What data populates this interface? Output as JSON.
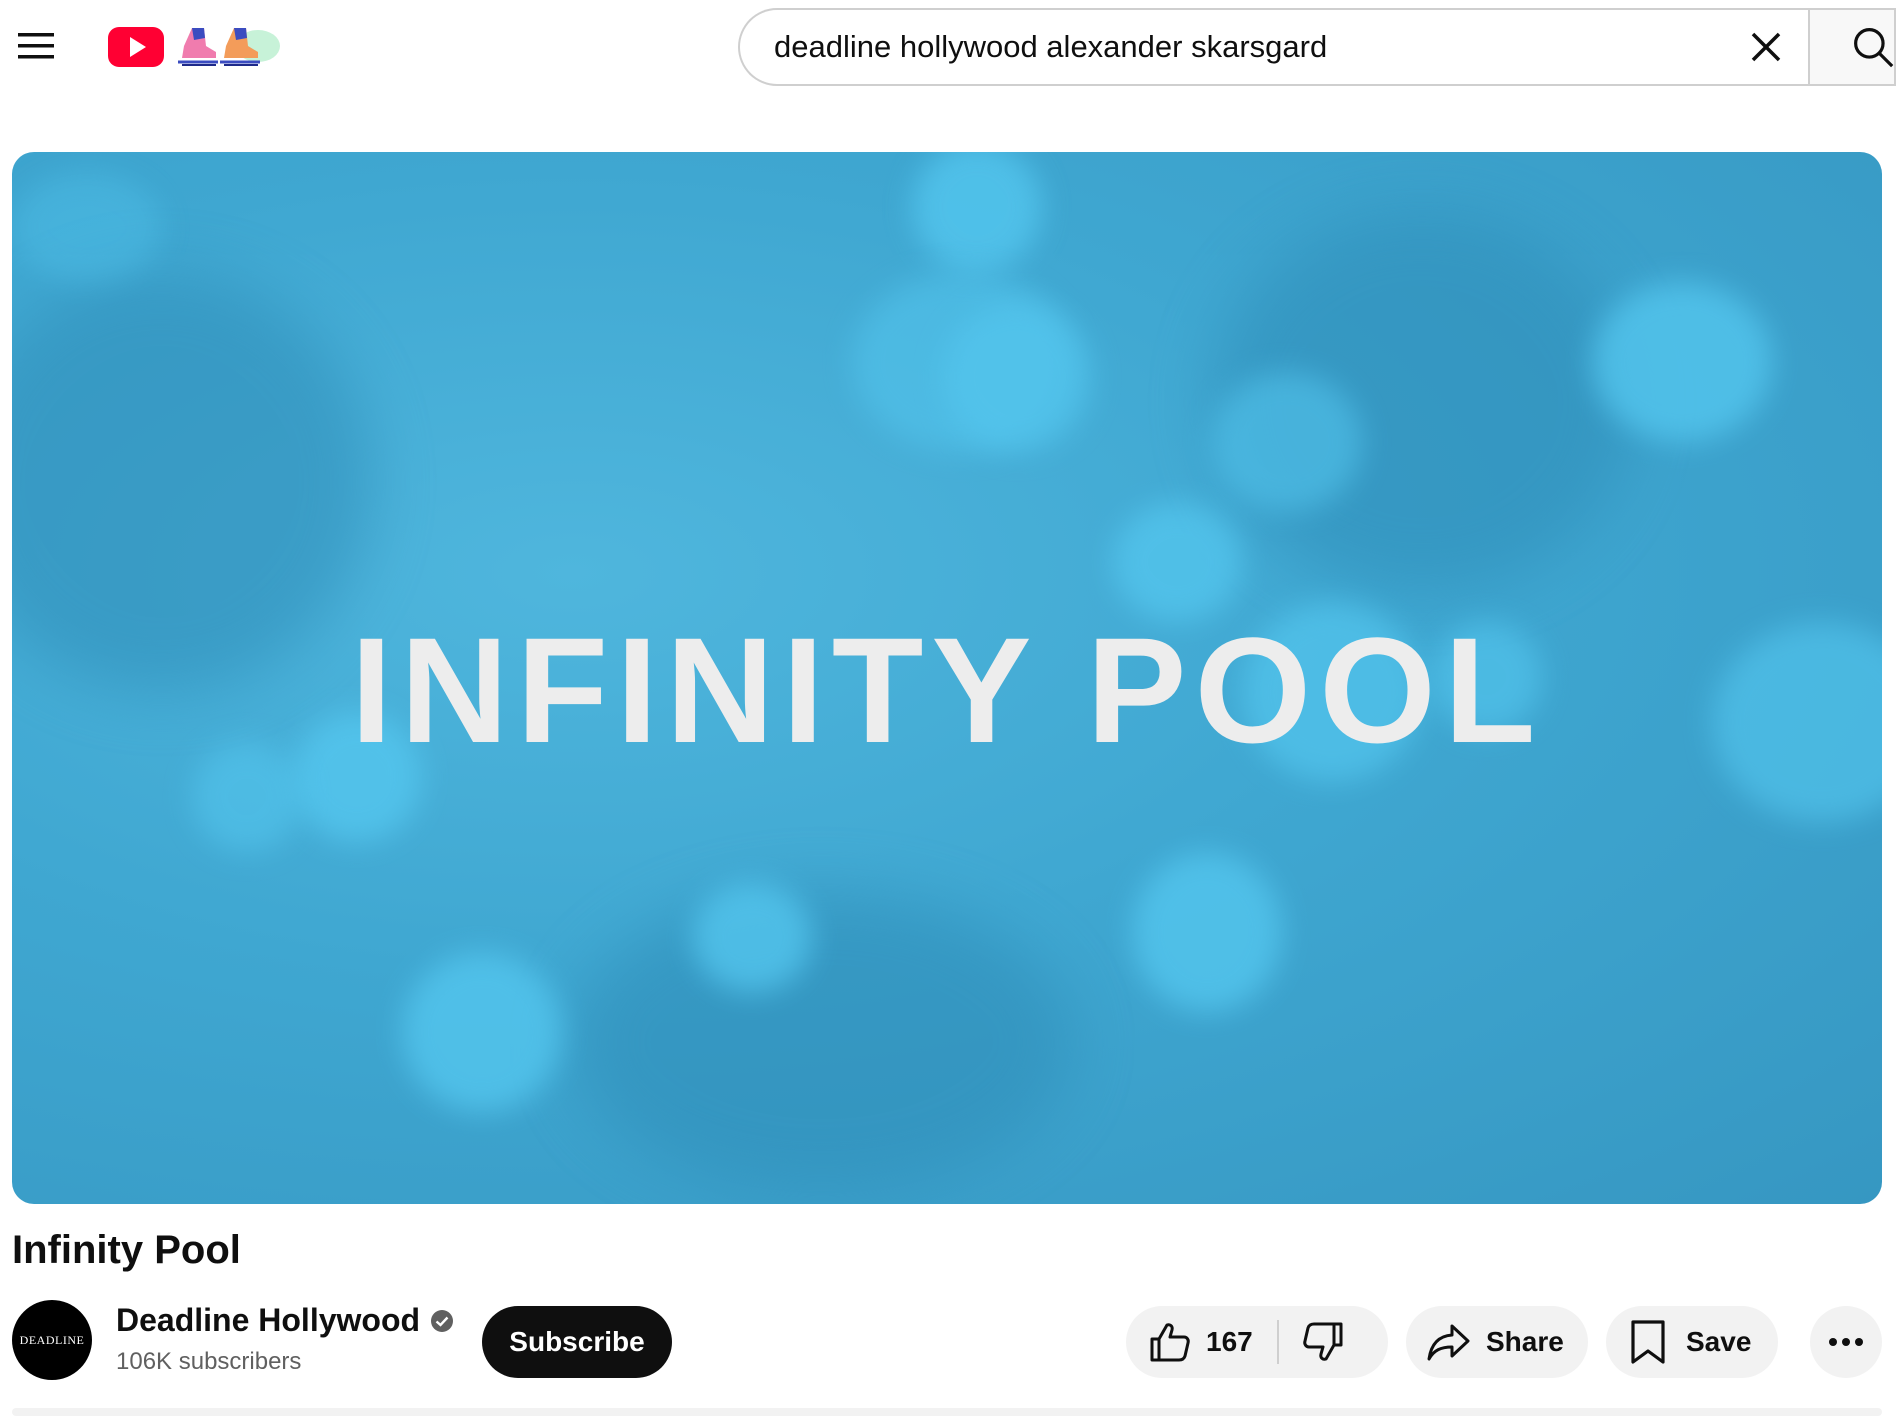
{
  "header": {
    "search_value": "deadline hollywood alexander skarsgard",
    "menu_icon": "hamburger-menu-icon",
    "logo_icon": "youtube-logo-icon",
    "doodle_icon": "ice-skates-doodle-icon",
    "clear_icon": "close-icon",
    "search_icon": "search-icon"
  },
  "player": {
    "overlay_text": "INFINITY POOL"
  },
  "video": {
    "title": "Infinity Pool"
  },
  "channel": {
    "name": "Deadline Hollywood",
    "avatar_text": "DEADLINE",
    "subscribers": "106K subscribers",
    "verified_icon": "verified-check-icon"
  },
  "actions": {
    "subscribe_label": "Subscribe",
    "like_count": "167",
    "share_label": "Share",
    "save_label": "Save"
  },
  "colors": {
    "brand_red": "#ff0033",
    "player_blue": "#3fa7d1",
    "subscribe_bg": "#0f0f0f",
    "pill_bg": "#f2f2f2"
  }
}
